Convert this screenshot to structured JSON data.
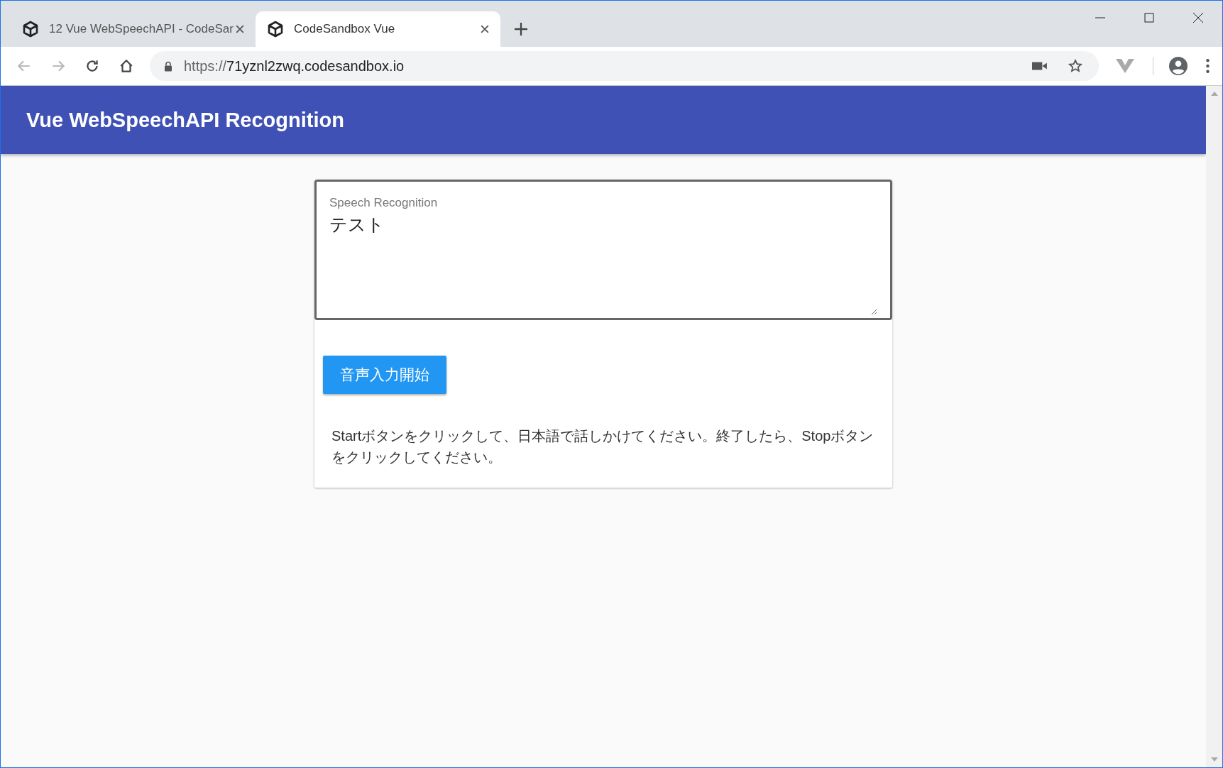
{
  "browser": {
    "tabs": [
      {
        "title": "12 Vue WebSpeechAPI - CodeSar",
        "selected": false
      },
      {
        "title": "CodeSandbox Vue",
        "selected": true
      }
    ],
    "address": {
      "scheme": "https://",
      "host": "71yznl2zwq.codesandbox.io"
    }
  },
  "app_bar": {
    "title": "Vue WebSpeechAPI Recognition"
  },
  "speech_field": {
    "label": "Speech Recognition",
    "value": "テスト"
  },
  "start_button": {
    "label": "音声入力開始"
  },
  "instructions": "Startボタンをクリックして、日本語で話しかけてください。終了したら、Stopボタンをクリックしてください。"
}
